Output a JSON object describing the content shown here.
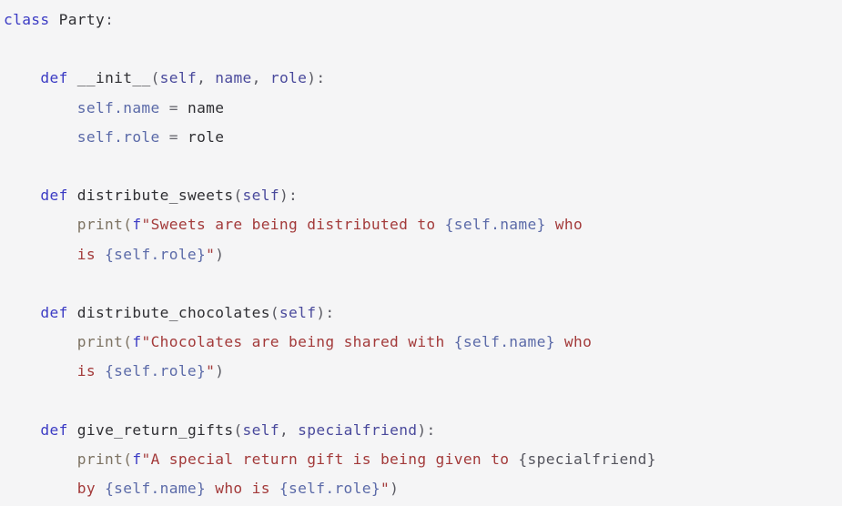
{
  "document": {
    "kind": "python-source-code",
    "language": "Python",
    "background_color": "#f5f5f6",
    "theme_colors": {
      "keyword": "#3b3bc4",
      "identifier": "#2f2f33",
      "builtin": "#7d7363",
      "punctuation": "#5a5a62",
      "parameter": "#4a4a9c",
      "self_attribute": "#5b6aa8",
      "operator": "#6a6a72",
      "string": "#a33a3a",
      "interpolation": "#5b6aa8"
    },
    "plain_text": "class Party:\n\n    def __init__(self, name, role):\n        self.name = name\n        self.role = role\n\n    def distribute_sweets(self):\n        print(f\"Sweets are being distributed to {self.name} who\n        is {self.role}\")\n\n    def distribute_chocolates(self):\n        print(f\"Chocolates are being shared with {self.name} who\n        is {self.role}\")\n\n    def give_return_gifts(self, specialfriend):\n        print(f\"A special return gift is being given to {specialfriend}\n        by {self.name} who is {self.role}\")",
    "class_name": "Party",
    "methods": [
      "__init__",
      "distribute_sweets",
      "distribute_chocolates",
      "give_return_gifts"
    ],
    "lines": [
      {
        "n": 1,
        "tokens": [
          {
            "t": "class",
            "c": "tok-keyword"
          },
          {
            "t": " ",
            "c": "tok-punct"
          },
          {
            "t": "Party",
            "c": "tok-name"
          },
          {
            "t": ":",
            "c": "tok-punct"
          }
        ]
      },
      {
        "n": 2,
        "blank": true,
        "tokens": []
      },
      {
        "n": 3,
        "tokens": [
          {
            "t": "    ",
            "c": "tok-punct"
          },
          {
            "t": "def",
            "c": "tok-keyword"
          },
          {
            "t": " ",
            "c": "tok-punct"
          },
          {
            "t": "__init__",
            "c": "tok-name"
          },
          {
            "t": "(",
            "c": "tok-punct"
          },
          {
            "t": "self",
            "c": "tok-param"
          },
          {
            "t": ", ",
            "c": "tok-punct"
          },
          {
            "t": "name",
            "c": "tok-param"
          },
          {
            "t": ", ",
            "c": "tok-punct"
          },
          {
            "t": "role",
            "c": "tok-param"
          },
          {
            "t": "):",
            "c": "tok-punct"
          }
        ]
      },
      {
        "n": 4,
        "tokens": [
          {
            "t": "        ",
            "c": "tok-punct"
          },
          {
            "t": "self.name",
            "c": "tok-selfattr"
          },
          {
            "t": " ",
            "c": "tok-punct"
          },
          {
            "t": "=",
            "c": "tok-operator"
          },
          {
            "t": " ",
            "c": "tok-punct"
          },
          {
            "t": "name",
            "c": "tok-name"
          }
        ]
      },
      {
        "n": 5,
        "tokens": [
          {
            "t": "        ",
            "c": "tok-punct"
          },
          {
            "t": "self.role",
            "c": "tok-selfattr"
          },
          {
            "t": " ",
            "c": "tok-punct"
          },
          {
            "t": "=",
            "c": "tok-operator"
          },
          {
            "t": " ",
            "c": "tok-punct"
          },
          {
            "t": "role",
            "c": "tok-name"
          }
        ]
      },
      {
        "n": 6,
        "blank": true,
        "tokens": []
      },
      {
        "n": 7,
        "tokens": [
          {
            "t": "    ",
            "c": "tok-punct"
          },
          {
            "t": "def",
            "c": "tok-keyword"
          },
          {
            "t": " ",
            "c": "tok-punct"
          },
          {
            "t": "distribute_sweets",
            "c": "tok-name"
          },
          {
            "t": "(",
            "c": "tok-punct"
          },
          {
            "t": "self",
            "c": "tok-param"
          },
          {
            "t": "):",
            "c": "tok-punct"
          }
        ]
      },
      {
        "n": 8,
        "tokens": [
          {
            "t": "        ",
            "c": "tok-punct"
          },
          {
            "t": "print",
            "c": "tok-builtin"
          },
          {
            "t": "(",
            "c": "tok-builtin"
          },
          {
            "t": "f",
            "c": "tok-keyword"
          },
          {
            "t": "\"Sweets are being distributed to ",
            "c": "tok-string"
          },
          {
            "t": "{self.name}",
            "c": "tok-interp"
          },
          {
            "t": " who",
            "c": "tok-string"
          }
        ]
      },
      {
        "n": 9,
        "tokens": [
          {
            "t": "        ",
            "c": "tok-punct"
          },
          {
            "t": "is ",
            "c": "tok-string"
          },
          {
            "t": "{self.role}",
            "c": "tok-interp"
          },
          {
            "t": "\"",
            "c": "tok-string"
          },
          {
            "t": ")",
            "c": "tok-punct"
          }
        ]
      },
      {
        "n": 10,
        "blank": true,
        "tokens": []
      },
      {
        "n": 11,
        "tokens": [
          {
            "t": "    ",
            "c": "tok-punct"
          },
          {
            "t": "def",
            "c": "tok-keyword"
          },
          {
            "t": " ",
            "c": "tok-punct"
          },
          {
            "t": "distribute_chocolates",
            "c": "tok-name"
          },
          {
            "t": "(",
            "c": "tok-punct"
          },
          {
            "t": "self",
            "c": "tok-param"
          },
          {
            "t": "):",
            "c": "tok-punct"
          }
        ]
      },
      {
        "n": 12,
        "tokens": [
          {
            "t": "        ",
            "c": "tok-punct"
          },
          {
            "t": "print",
            "c": "tok-builtin"
          },
          {
            "t": "(",
            "c": "tok-builtin"
          },
          {
            "t": "f",
            "c": "tok-keyword"
          },
          {
            "t": "\"Chocolates are being shared with ",
            "c": "tok-string"
          },
          {
            "t": "{self.name}",
            "c": "tok-interp"
          },
          {
            "t": " who",
            "c": "tok-string"
          }
        ]
      },
      {
        "n": 13,
        "tokens": [
          {
            "t": "        ",
            "c": "tok-punct"
          },
          {
            "t": "is ",
            "c": "tok-string"
          },
          {
            "t": "{self.role}",
            "c": "tok-interp"
          },
          {
            "t": "\"",
            "c": "tok-string"
          },
          {
            "t": ")",
            "c": "tok-punct"
          }
        ]
      },
      {
        "n": 14,
        "blank": true,
        "tokens": []
      },
      {
        "n": 15,
        "tokens": [
          {
            "t": "    ",
            "c": "tok-punct"
          },
          {
            "t": "def",
            "c": "tok-keyword"
          },
          {
            "t": " ",
            "c": "tok-punct"
          },
          {
            "t": "give_return_gifts",
            "c": "tok-name"
          },
          {
            "t": "(",
            "c": "tok-punct"
          },
          {
            "t": "self",
            "c": "tok-param"
          },
          {
            "t": ", ",
            "c": "tok-punct"
          },
          {
            "t": "specialfriend",
            "c": "tok-param"
          },
          {
            "t": "):",
            "c": "tok-punct"
          }
        ]
      },
      {
        "n": 16,
        "tokens": [
          {
            "t": "        ",
            "c": "tok-punct"
          },
          {
            "t": "print",
            "c": "tok-builtin"
          },
          {
            "t": "(",
            "c": "tok-builtin"
          },
          {
            "t": "f",
            "c": "tok-keyword"
          },
          {
            "t": "\"A special return gift is being given to ",
            "c": "tok-string"
          },
          {
            "t": "{specialfriend}",
            "c": "tok-interp2"
          }
        ]
      },
      {
        "n": 17,
        "tokens": [
          {
            "t": "        ",
            "c": "tok-punct"
          },
          {
            "t": "by ",
            "c": "tok-string"
          },
          {
            "t": "{self.name}",
            "c": "tok-interp"
          },
          {
            "t": " who is ",
            "c": "tok-string"
          },
          {
            "t": "{self.role}",
            "c": "tok-interp"
          },
          {
            "t": "\"",
            "c": "tok-string"
          },
          {
            "t": ")",
            "c": "tok-punct"
          }
        ]
      }
    ]
  }
}
